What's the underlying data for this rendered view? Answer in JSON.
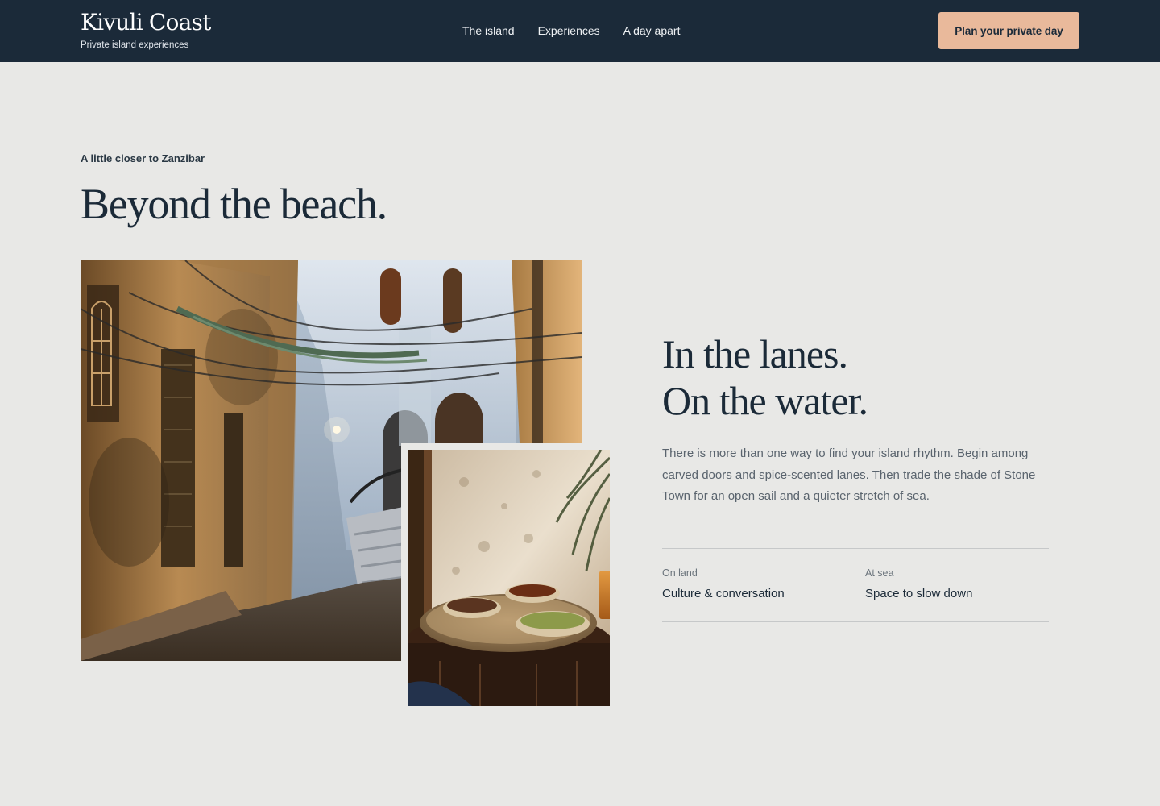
{
  "header": {
    "brand_name": "Kivuli Coast",
    "brand_tagline": "Private island experiences",
    "nav": [
      {
        "label": "The island"
      },
      {
        "label": "Experiences"
      },
      {
        "label": "A day apart"
      }
    ],
    "cta_label": "Plan your private day"
  },
  "intro": {
    "eyebrow": "A little closer to Zanzibar",
    "title": "Beyond the beach."
  },
  "photos": {
    "lane": {
      "alt": "Narrow Stone Town lane with weathered walls and overhead wires"
    },
    "table": {
      "alt": "Brass tray with bowls of spices on a carved wooden table"
    }
  },
  "feature": {
    "heading_line1": "In the lanes.",
    "heading_line2": "On the water.",
    "body": "There is more than one way to find your island rhythm. Begin among carved doors and spice-scented lanes. Then trade the shade of Stone Town for an open sail and a quieter stretch of sea.",
    "facts": [
      {
        "label": "On land",
        "value": "Culture & conversation"
      },
      {
        "label": "At sea",
        "value": "Space to slow down"
      }
    ]
  },
  "colors": {
    "header_bg": "#1b2a39",
    "page_bg": "#e8e8e6",
    "accent": "#e9b99b",
    "heading_text": "#1b2a38",
    "body_text": "#5a646e"
  }
}
